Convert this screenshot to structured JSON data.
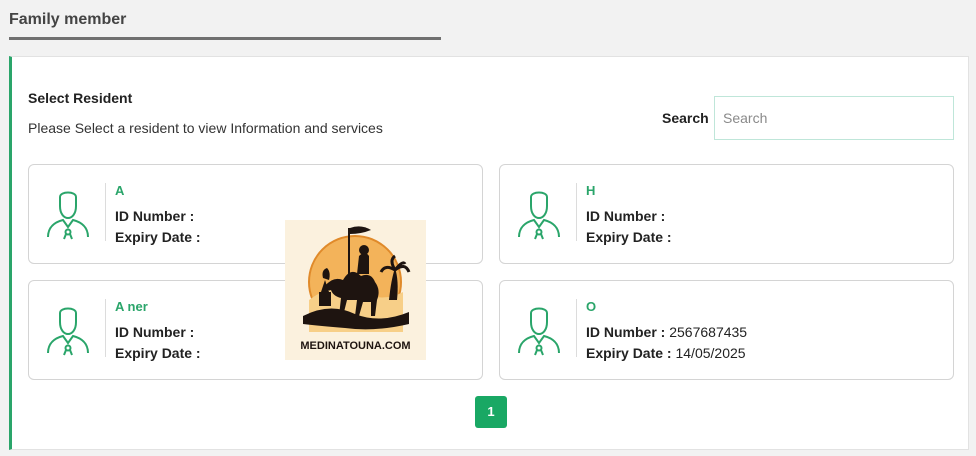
{
  "tab": {
    "title": "Family member"
  },
  "panel": {
    "heading": "Select Resident",
    "subtext": "Please Select a resident to view Information and services"
  },
  "search": {
    "label": "Search",
    "placeholder": "Search",
    "value": ""
  },
  "labels": {
    "id_number": "ID Number :",
    "expiry_date": "Expiry Date :"
  },
  "residents": [
    {
      "name": "A",
      "id_number": "",
      "expiry_date": ""
    },
    {
      "name": "H",
      "id_number": "",
      "expiry_date": ""
    },
    {
      "name": "A  ner",
      "id_number": "",
      "expiry_date": ""
    },
    {
      "name": "O",
      "id_number": "2567687435",
      "expiry_date": "14/05/2025"
    }
  ],
  "watermark": {
    "text": "MEDINATOUNA.COM"
  },
  "pagination": {
    "current_page": "1"
  },
  "colors": {
    "accent": "#2aa56a",
    "pager": "#19a864"
  },
  "icons": {
    "avatar": "person-outline-icon"
  }
}
